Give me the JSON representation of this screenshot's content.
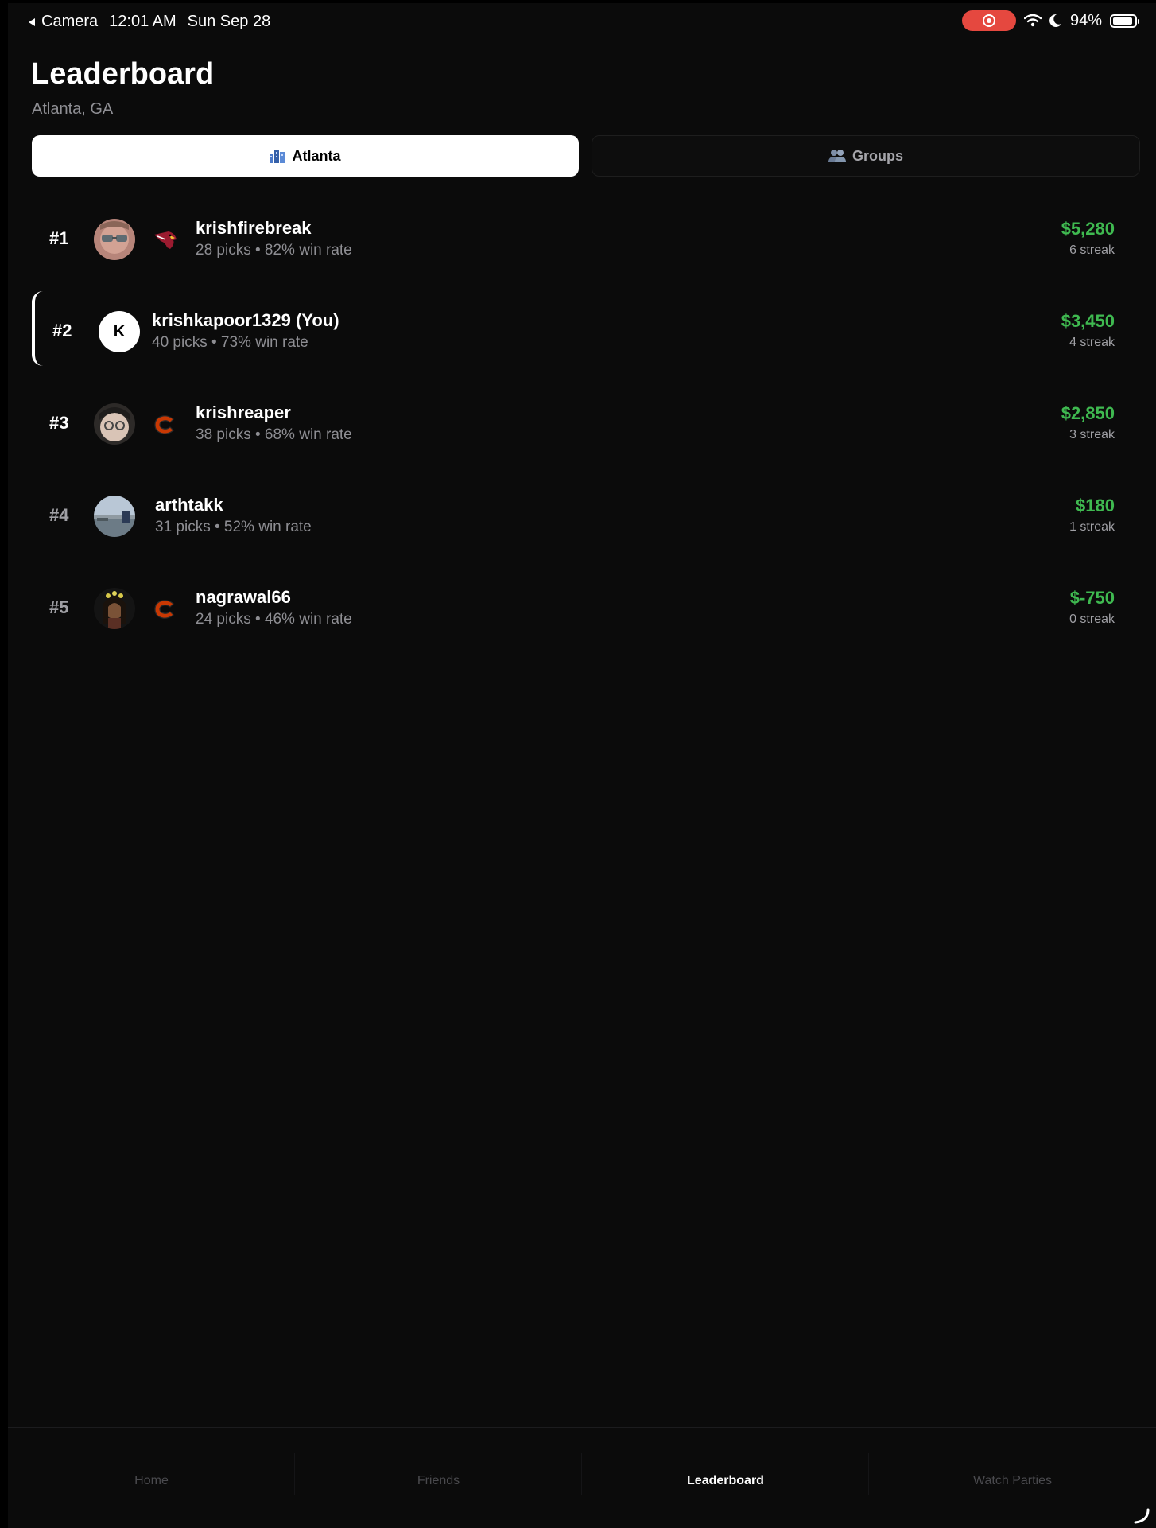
{
  "status_bar": {
    "back_label": "Camera",
    "time": "12:01 AM",
    "date": "Sun Sep 28",
    "battery": "94%",
    "battery_level": 0.94
  },
  "header": {
    "title": "Leaderboard",
    "subtitle": "Atlanta, GA"
  },
  "segments": {
    "atlanta": "Atlanta",
    "groups": "Groups"
  },
  "rows": [
    {
      "rank": "#1",
      "name": "krishfirebreak",
      "stats": "28 picks • 82% win rate",
      "amount": "$5,280",
      "streak": "6 streak",
      "team_icon": "cardinals-logo-icon"
    },
    {
      "rank": "#2",
      "name": "krishkapoor1329 (You)",
      "stats": "40 picks • 73% win rate",
      "amount": "$3,450",
      "streak": "4 streak",
      "avatar_initial": "K"
    },
    {
      "rank": "#3",
      "name": "krishreaper",
      "stats": "38 picks • 68% win rate",
      "amount": "$2,850",
      "streak": "3 streak",
      "team_icon": "bears-logo-icon"
    },
    {
      "rank": "#4",
      "name": "arthtakk",
      "stats": "31 picks • 52% win rate",
      "amount": "$180",
      "streak": "1 streak"
    },
    {
      "rank": "#5",
      "name": "nagrawal66",
      "stats": "24 picks • 46% win rate",
      "amount": "$-750",
      "streak": "0 streak",
      "team_icon": "bears-logo-icon"
    }
  ],
  "tabs": {
    "home": "Home",
    "friends": "Friends",
    "leaderboard": "Leaderboard",
    "watch_parties": "Watch Parties"
  },
  "colors": {
    "accent_green": "#3fb950",
    "background": "#0b0b0b",
    "record_red": "#e5483f"
  }
}
